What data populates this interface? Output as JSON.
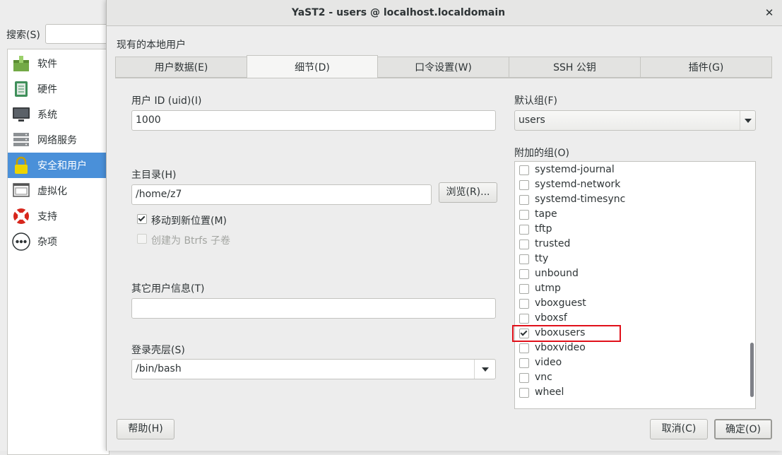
{
  "background": {
    "search_label": "搜索(S)",
    "categories": [
      {
        "label": "软件",
        "icon": "software-icon",
        "selected": false
      },
      {
        "label": "硬件",
        "icon": "hardware-icon",
        "selected": false
      },
      {
        "label": "系统",
        "icon": "system-icon",
        "selected": false
      },
      {
        "label": "网络服务",
        "icon": "network-services-icon",
        "selected": false
      },
      {
        "label": "安全和用户",
        "icon": "lock-icon",
        "selected": true
      },
      {
        "label": "虚拟化",
        "icon": "virtualization-icon",
        "selected": false
      },
      {
        "label": "支持",
        "icon": "lifebuoy-icon",
        "selected": false
      },
      {
        "label": "杂项",
        "icon": "more-icon",
        "selected": false
      }
    ]
  },
  "dialog": {
    "title": "YaST2 - users @ localhost.localdomain",
    "section_title": "现有的本地用户",
    "tabs": [
      {
        "label": "用户数据(E)",
        "active": false
      },
      {
        "label": "细节(D)",
        "active": true
      },
      {
        "label": "口令设置(W)",
        "active": false
      },
      {
        "label": "SSH 公钥",
        "active": false
      },
      {
        "label": "插件(G)",
        "active": false
      }
    ],
    "uid_label": "用户 ID (uid)(I)",
    "uid_value": "1000",
    "home_label": "主目录(H)",
    "home_value": "/home/z7",
    "browse_button": "浏览(R)...",
    "move_to_new_label": "移动到新位置(M)",
    "move_to_new_checked": true,
    "btrfs_label": "创建为 Btrfs 子卷",
    "btrfs_checked": false,
    "other_info_label": "其它用户信息(T)",
    "other_info_value": "",
    "shell_label": "登录壳层(S)",
    "shell_value": "/bin/bash",
    "default_group_label": "默认组(F)",
    "default_group_value": "users",
    "additional_groups_label": "附加的组(O)",
    "groups": [
      {
        "name": "systemd-journal",
        "checked": false
      },
      {
        "name": "systemd-network",
        "checked": false
      },
      {
        "name": "systemd-timesync",
        "checked": false
      },
      {
        "name": "tape",
        "checked": false
      },
      {
        "name": "tftp",
        "checked": false
      },
      {
        "name": "trusted",
        "checked": false
      },
      {
        "name": "tty",
        "checked": false
      },
      {
        "name": "unbound",
        "checked": false
      },
      {
        "name": "utmp",
        "checked": false
      },
      {
        "name": "vboxguest",
        "checked": false
      },
      {
        "name": "vboxsf",
        "checked": false
      },
      {
        "name": "vboxusers",
        "checked": true
      },
      {
        "name": "vboxvideo",
        "checked": false
      },
      {
        "name": "video",
        "checked": false
      },
      {
        "name": "vnc",
        "checked": false
      },
      {
        "name": "wheel",
        "checked": false
      }
    ],
    "help_button": "帮助(H)",
    "cancel_button": "取消(C)",
    "ok_button": "确定(O)"
  },
  "colors": {
    "selection": "#4a90d9",
    "highlight": "#e0101a",
    "window_bg": "#ededed"
  }
}
